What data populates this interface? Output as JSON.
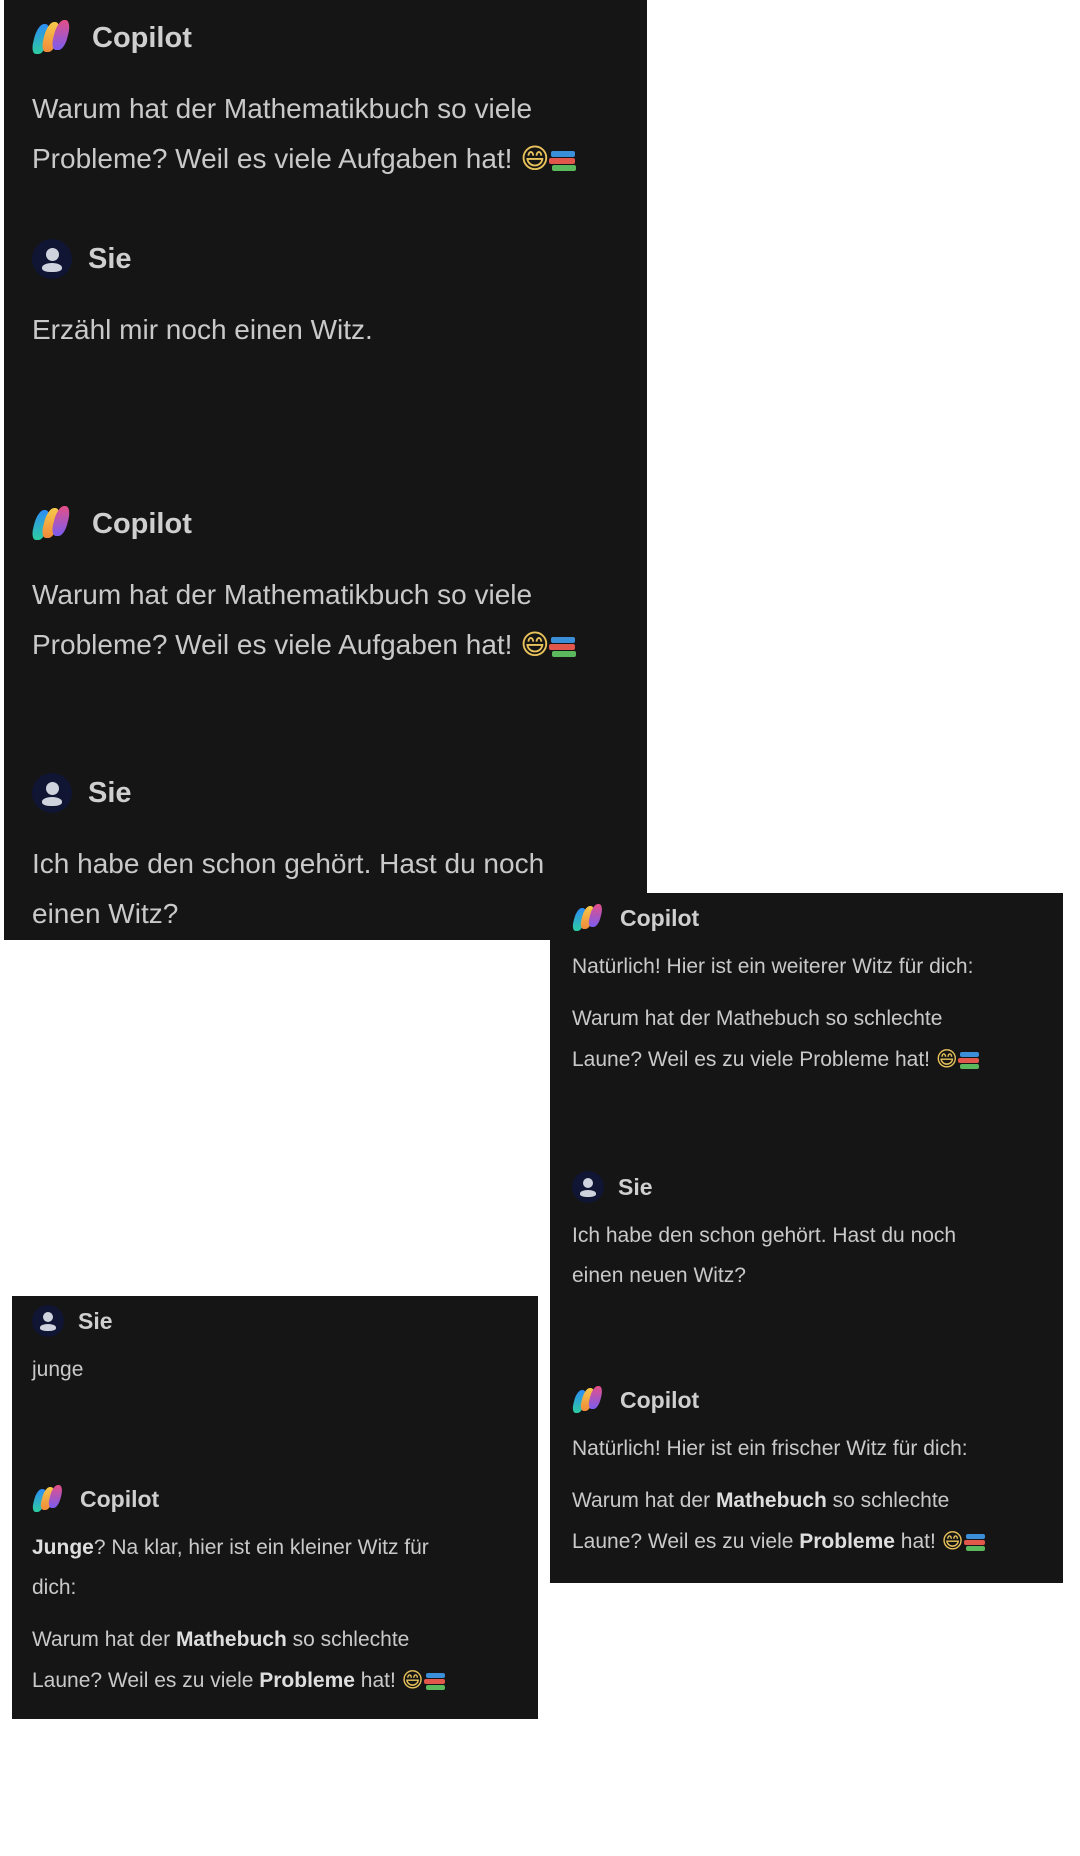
{
  "panel1": {
    "messages": [
      {
        "author": "Copilot",
        "role": "copilot",
        "lines": [
          "Warum hat der Mathematikbuch so viele",
          "Probleme? Weil es viele Aufgaben hat!"
        ],
        "emoji": "😄"
      },
      {
        "author": "Sie",
        "role": "user",
        "lines": [
          "Erzähl mir noch einen Witz."
        ]
      },
      {
        "author": "Copilot",
        "role": "copilot",
        "lines": [
          "Warum hat der Mathematikbuch so viele",
          "Probleme? Weil es viele Aufgaben hat!"
        ],
        "emoji": "😄"
      },
      {
        "author": "Sie",
        "role": "user",
        "lines": [
          "Ich habe den schon gehört. Hast du noch",
          "einen Witz?"
        ]
      }
    ]
  },
  "panel2": {
    "m1": {
      "author": "Copilot",
      "intro": "Natürlich! Hier ist ein weiterer Witz für dich:",
      "line1": "Warum hat der Mathebuch so schlechte",
      "line2": "Laune? Weil es zu viele Probleme hat!",
      "emoji": "😄"
    },
    "m2": {
      "author": "Sie",
      "line1": "Ich habe den schon gehört. Hast du noch",
      "line2": "einen neuen Witz?"
    },
    "m3": {
      "author": "Copilot",
      "intro": "Natürlich! Hier ist ein frischer Witz für dich:",
      "l1_a": "Warum hat der ",
      "l1_b": "Mathebuch",
      "l1_c": " so schlechte",
      "l2_a": "Laune? Weil es zu viele ",
      "l2_b": "Probleme",
      "l2_c": " hat!",
      "emoji": "😄"
    }
  },
  "panel3": {
    "m1": {
      "author": "Sie",
      "text": "junge"
    },
    "m2": {
      "author": "Copilot",
      "intro_a": "Junge",
      "intro_b": "? Na klar, hier ist ein kleiner Witz für",
      "intro_c": "dich:",
      "l1_a": "Warum hat der ",
      "l1_b": "Mathebuch",
      "l1_c": " so schlechte",
      "l2_a": "Laune? Weil es zu viele ",
      "l2_b": "Probleme",
      "l2_c": " hat!",
      "emoji": "😄"
    }
  },
  "icons": {
    "copilot": "copilot-logo-icon",
    "user": "user-avatar-icon",
    "books": "books-emoji-icon"
  },
  "colors": {
    "panel_bg": "#161515",
    "text": "#c9c9c9",
    "author": "#cfcfcf",
    "avatar_bg": "#0f1533"
  }
}
